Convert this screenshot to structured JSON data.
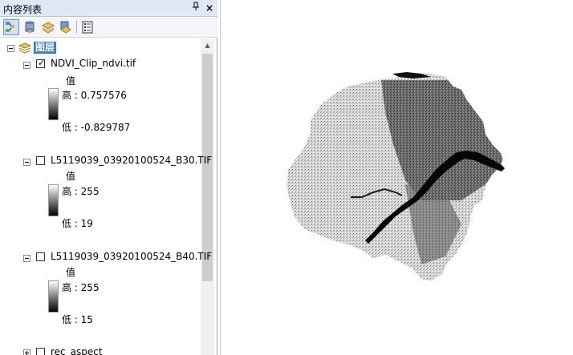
{
  "toc": {
    "title": "内容列表",
    "pin_glyph": "ᵠ",
    "close_glyph": "×",
    "toolbar": [
      "list-by-drawing-order-icon",
      "list-by-source-icon",
      "list-by-visibility-icon",
      "list-by-selection-icon",
      "options-icon"
    ],
    "group": {
      "label": "图层",
      "icon": "layers-icon"
    },
    "layers": [
      {
        "name": "NDVI_Clip_ndvi.tif",
        "checked": true,
        "value_heading": "值",
        "high": "高 : 0.757576",
        "low": "低 : -0.829787"
      },
      {
        "name": "L5119039_03920100524_B30.TIF",
        "checked": false,
        "value_heading": "值",
        "high": "高 : 255",
        "low": "低 : 19"
      },
      {
        "name": "L5119039_03920100524_B40.TIF",
        "checked": false,
        "value_heading": "值",
        "high": "高 : 255",
        "low": "低 : 15"
      },
      {
        "name": "rec_aspect",
        "checked": false
      }
    ]
  },
  "map": {
    "content": "NDVI grayscale raster of a city region with a river",
    "colors": {
      "background": "#ffffff",
      "raster_light": "#d8d8d8",
      "raster_dark": "#3a3a3a",
      "river": "#050505"
    }
  }
}
